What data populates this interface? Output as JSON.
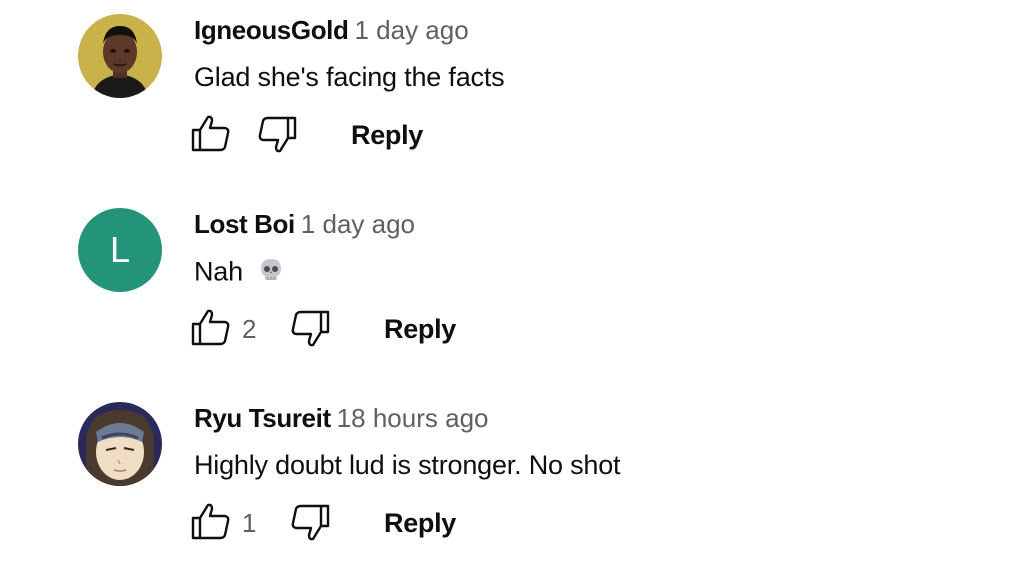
{
  "comments": [
    {
      "author": "IgneousGold",
      "time": "1 day ago",
      "text": "Glad she's facing the facts",
      "likes": "",
      "reply_label": "Reply",
      "avatar_type": "photo",
      "avatar_bg": "#c9b24a"
    },
    {
      "author": "Lost Boi",
      "time": "1 day ago",
      "text": "Nah",
      "emoji_icon": "skull-icon",
      "likes": "2",
      "reply_label": "Reply",
      "avatar_type": "letter",
      "avatar_letter": "L",
      "avatar_bg": "#23947a"
    },
    {
      "author": "Ryu Tsureit",
      "time": "18 hours ago",
      "text": "Highly doubt lud is stronger. No shot",
      "likes": "1",
      "reply_label": "Reply",
      "avatar_type": "anime",
      "avatar_bg": "#2a2a5a"
    }
  ]
}
